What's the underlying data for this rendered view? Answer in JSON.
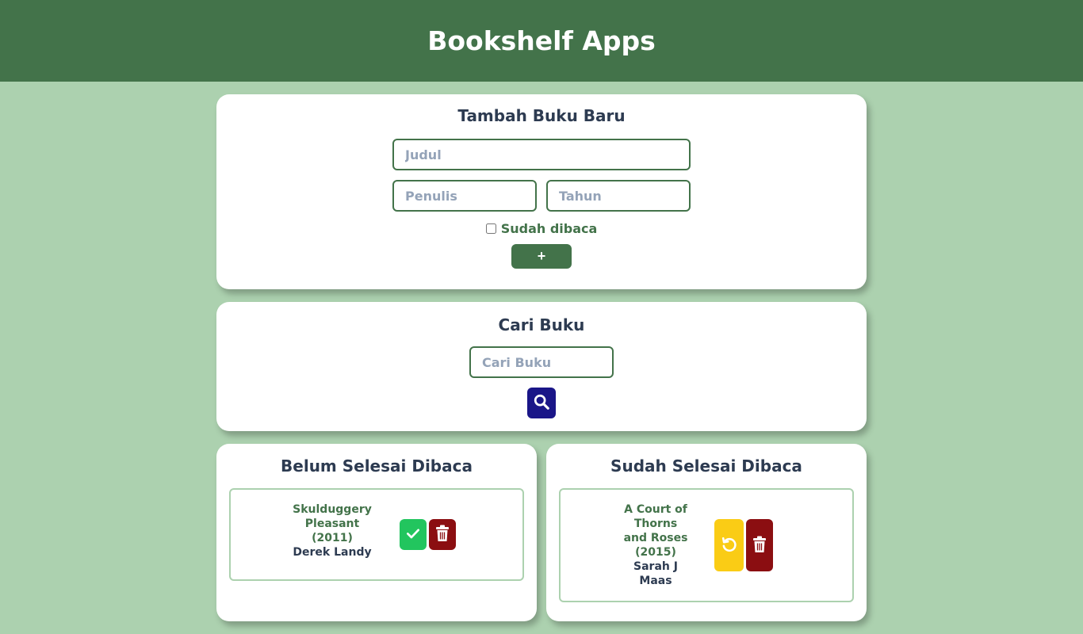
{
  "app": {
    "title": "Bookshelf Apps"
  },
  "add_form": {
    "title": "Tambah Buku Baru",
    "judul_placeholder": "Judul",
    "penulis_placeholder": "Penulis",
    "tahun_placeholder": "Tahun",
    "checkbox_label": "Sudah dibaca",
    "checkbox_checked": false,
    "submit_label": "+"
  },
  "search": {
    "title": "Cari Buku",
    "placeholder": "Cari Buku",
    "button_icon": "search-icon"
  },
  "unread": {
    "title": "Belum Selesai Dibaca",
    "books": [
      {
        "title_line1": "Skulduggery",
        "title_line2": "Pleasant",
        "year": "(2011)",
        "author": "Derek Landy",
        "actions": [
          "check-icon",
          "trash-icon"
        ]
      }
    ]
  },
  "read": {
    "title": "Sudah Selesai Dibaca",
    "books": [
      {
        "title_line1": "A Court of",
        "title_line2": "Thorns",
        "title_line3": "and Roses",
        "year": "(2015)",
        "author_line1": "Sarah J",
        "author_line2": "Maas",
        "actions": [
          "undo-icon",
          "trash-icon"
        ]
      }
    ]
  },
  "colors": {
    "header": "#43734a",
    "background": "#acd1af",
    "card": "#ffffff",
    "heading_text": "#2d3b51",
    "accent_green": "#43734a",
    "search_button": "#1a1688",
    "done_button": "#22c55e",
    "delete_button": "#8b0e11",
    "undo_button": "#facc15"
  }
}
